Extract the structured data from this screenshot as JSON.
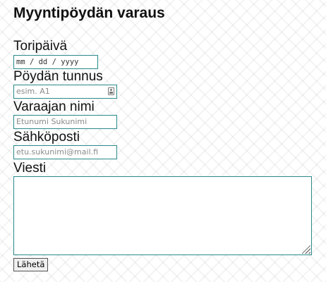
{
  "form": {
    "title": "Myyntipöydän varaus",
    "date_label": "Toripäivä",
    "date_format": "mm / dd / yyyy",
    "table_label": "Pöydän tunnus",
    "table_placeholder": "esim. A1",
    "name_label": "Varaajan nimi",
    "name_placeholder": "Etunumi Sukunimi",
    "email_label": "Sähköposti",
    "email_placeholder": "etu.sukunimi@mail.fi",
    "message_label": "Viesti",
    "message_value": "",
    "submit_label": "Lähetä"
  },
  "colors": {
    "input_border": "#2a8a8a",
    "placeholder_text": "#8a8a8a"
  }
}
